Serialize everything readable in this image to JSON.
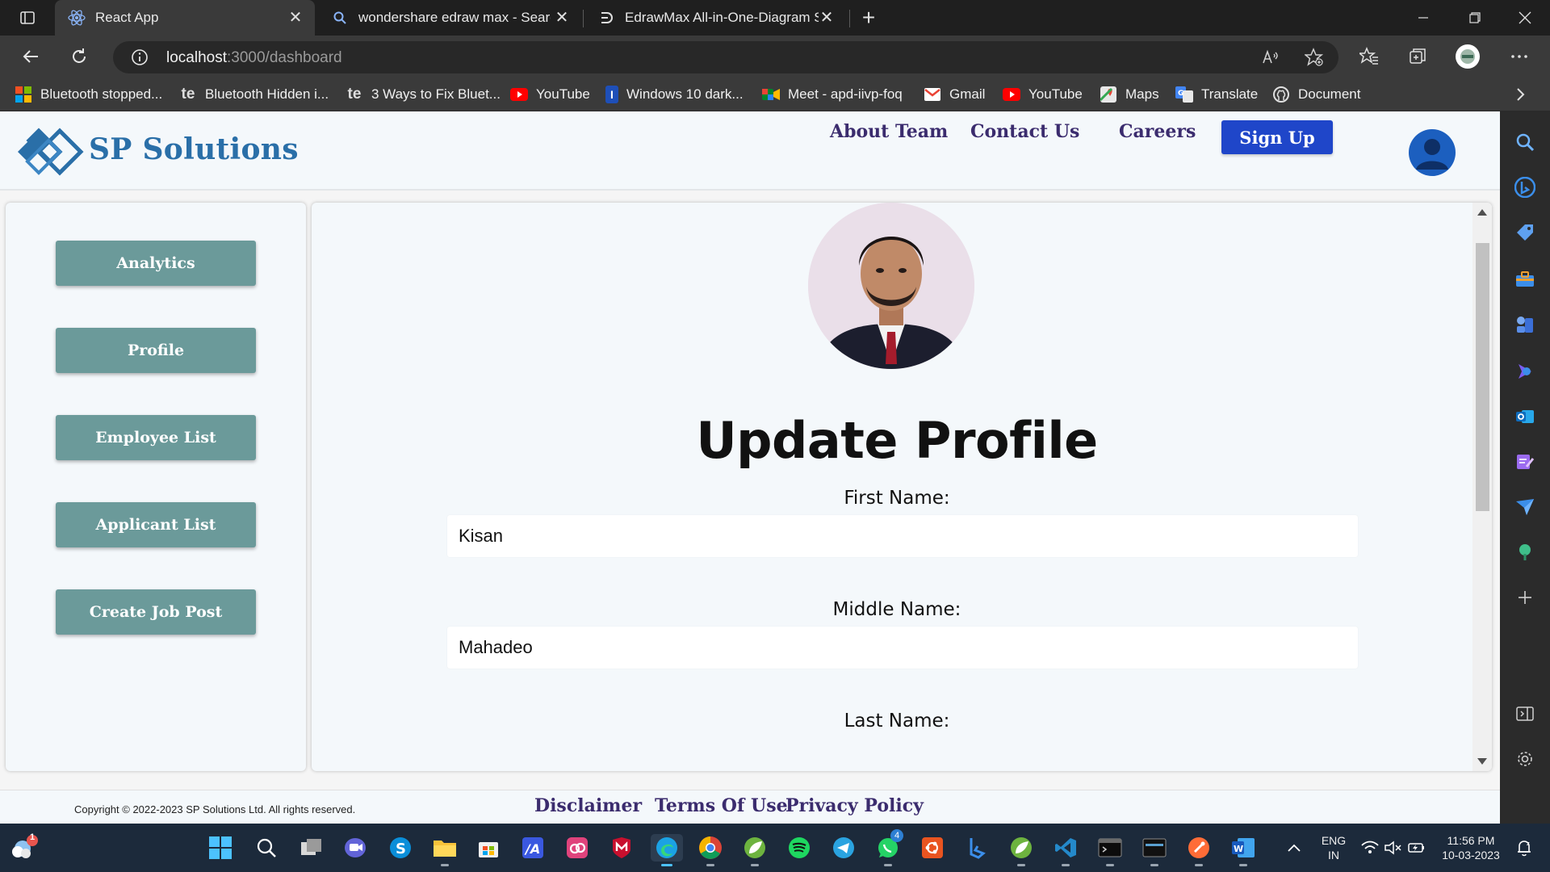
{
  "browser": {
    "tabs": [
      {
        "label": "React App",
        "icon": "react-icon",
        "active": true
      },
      {
        "label": "wondershare edraw max - Search",
        "icon": "search-icon",
        "active": false
      },
      {
        "label": "EdrawMax All-in-One-Diagram S",
        "icon": "edraw-icon",
        "active": false
      }
    ],
    "new_tab_label": "+",
    "url_host": "localhost",
    "url_path": ":3000/dashboard",
    "bookmarks": [
      {
        "label": "Bluetooth stopped...",
        "icon": "microsoft-icon"
      },
      {
        "label": "Bluetooth Hidden i...",
        "icon": "te-icon"
      },
      {
        "label": "3 Ways to Fix Bluet...",
        "icon": "te-icon"
      },
      {
        "label": "YouTube",
        "icon": "youtube-icon"
      },
      {
        "label": "Windows 10 dark...",
        "icon": "bookmark-i-icon"
      },
      {
        "label": "Meet - apd-iivp-foq",
        "icon": "meet-icon"
      },
      {
        "label": "Gmail",
        "icon": "gmail-icon"
      },
      {
        "label": "YouTube",
        "icon": "youtube-icon"
      },
      {
        "label": "Maps",
        "icon": "maps-icon"
      },
      {
        "label": "Translate",
        "icon": "translate-icon"
      },
      {
        "label": "Document",
        "icon": "github-icon"
      }
    ]
  },
  "header": {
    "brand": "SP Solutions",
    "nav": [
      "About Team",
      "Contact Us",
      "Careers"
    ],
    "signup_label": "Sign Up"
  },
  "sidebar": {
    "items": [
      {
        "label": "Analytics"
      },
      {
        "label": "Profile"
      },
      {
        "label": "Employee List"
      },
      {
        "label": "Applicant List"
      },
      {
        "label": "Create Job Post"
      }
    ]
  },
  "main": {
    "title": "Update Profile",
    "fields": [
      {
        "label": "First Name:",
        "value": "Kisan"
      },
      {
        "label": "Middle Name:",
        "value": "Mahadeo"
      },
      {
        "label": "Last Name:",
        "value": ""
      }
    ]
  },
  "footer": {
    "copyright": "Copyright © 2022-2023 SP Solutions Ltd. All rights reserved.",
    "links": [
      "Disclaimer",
      "Terms Of Use",
      "Privacy Policy"
    ]
  },
  "taskbar": {
    "language": "ENG",
    "region": "IN",
    "time": "11:56 PM",
    "date": "10-03-2023",
    "weather_badge": "1",
    "whatsapp_badge": "4"
  },
  "colors": {
    "brand": "#2a6fa8",
    "nav_link": "#3b2c6e",
    "signup": "#1f46c9",
    "menu_button": "#6b9a9a",
    "panel_bg": "#f4f8fb"
  }
}
